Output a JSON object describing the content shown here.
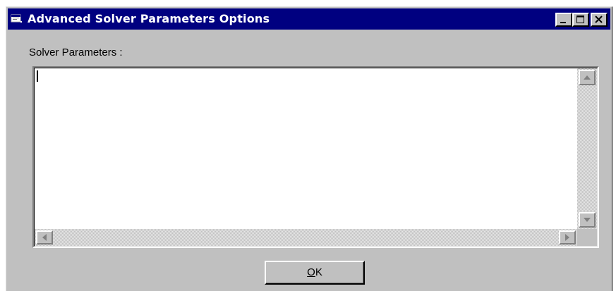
{
  "window": {
    "title": "Advanced Solver Parameters Options",
    "title_icon": "app-window-icon",
    "controls": {
      "minimize_icon": "minimize-icon",
      "maximize_icon": "maximize-icon",
      "close_icon": "close-icon"
    }
  },
  "main": {
    "params_label": "Solver Parameters :",
    "params_value": "",
    "scrollbar_icons": {
      "up": "arrow-up-icon",
      "down": "arrow-down-icon",
      "left": "arrow-left-icon",
      "right": "arrow-right-icon"
    }
  },
  "footer": {
    "ok_label_underlined": "O",
    "ok_label_rest": "K"
  },
  "colors": {
    "titlebar": "#000080",
    "window_face": "#c0c0c0",
    "textarea_bg": "#ffffff"
  }
}
